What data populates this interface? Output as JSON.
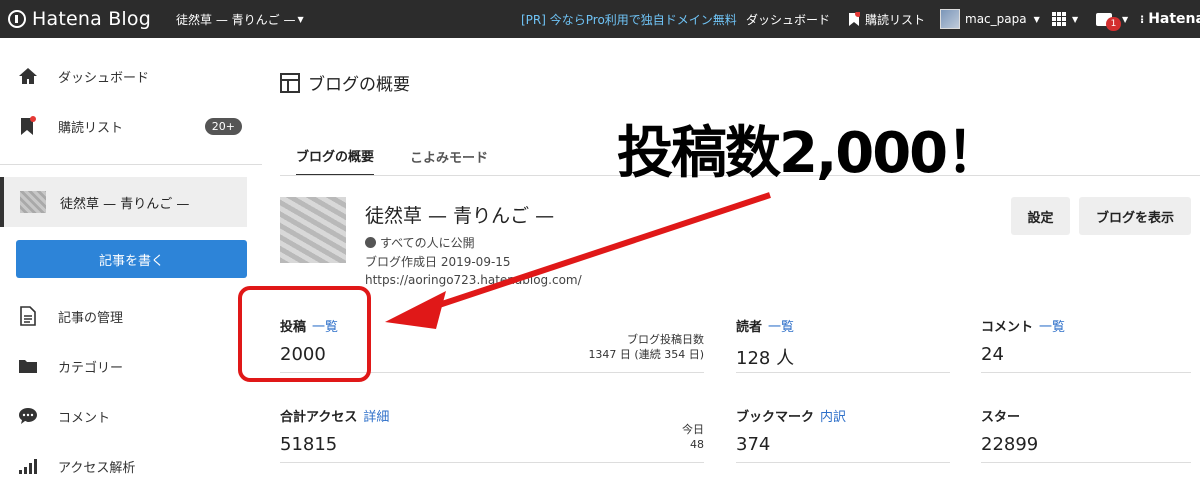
{
  "topbar": {
    "logo_text": "Hatena Blog",
    "blog_select": "徒然草 — 青りんご —",
    "pr_text": "[PR] 今ならPro利用で独自ドメイン無料",
    "dashboard": "ダッシュボード",
    "reader_list": "購読リスト",
    "username": "mac_papa",
    "notif_count": "1",
    "hatena": "Hatena"
  },
  "sidebar": {
    "dashboard": "ダッシュボード",
    "reader_list": "購読リスト",
    "reader_badge": "20+",
    "blog_name": "徒然草 — 青りんご —",
    "write_button": "記事を書く",
    "manage_posts": "記事の管理",
    "category": "カテゴリー",
    "comments": "コメント",
    "analytics": "アクセス解析"
  },
  "main": {
    "page_title": "ブログの概要",
    "tabs": [
      {
        "label": "ブログの概要"
      },
      {
        "label": "こよみモード"
      }
    ],
    "blog": {
      "name": "徒然草 — 青りんご —",
      "visibility": "すべての人に公開",
      "created": "ブログ作成日 2019-09-15",
      "url": "https://aoringo723.hatenablog.com/"
    },
    "settings_button": "設定",
    "view_blog_button": "ブログを表示",
    "stats": {
      "posts": {
        "label": "投稿",
        "link": "一覧",
        "value": "2000",
        "sub1": "ブログ投稿日数",
        "sub2": "1347 日 (連続 354 日)"
      },
      "readers": {
        "label": "読者",
        "link": "一覧",
        "value": "128 人"
      },
      "comments": {
        "label": "コメント",
        "link": "一覧",
        "value": "24"
      },
      "access": {
        "label": "合計アクセス",
        "link": "詳細",
        "value": "51815",
        "sub1": "今日",
        "sub2": "48"
      },
      "bookmarks": {
        "label": "ブックマーク",
        "link": "内訳",
        "value": "374"
      },
      "stars": {
        "label": "スター",
        "value": "22899"
      }
    }
  },
  "annotation": {
    "text": "投稿数2,000！",
    "color": "#e01818"
  }
}
